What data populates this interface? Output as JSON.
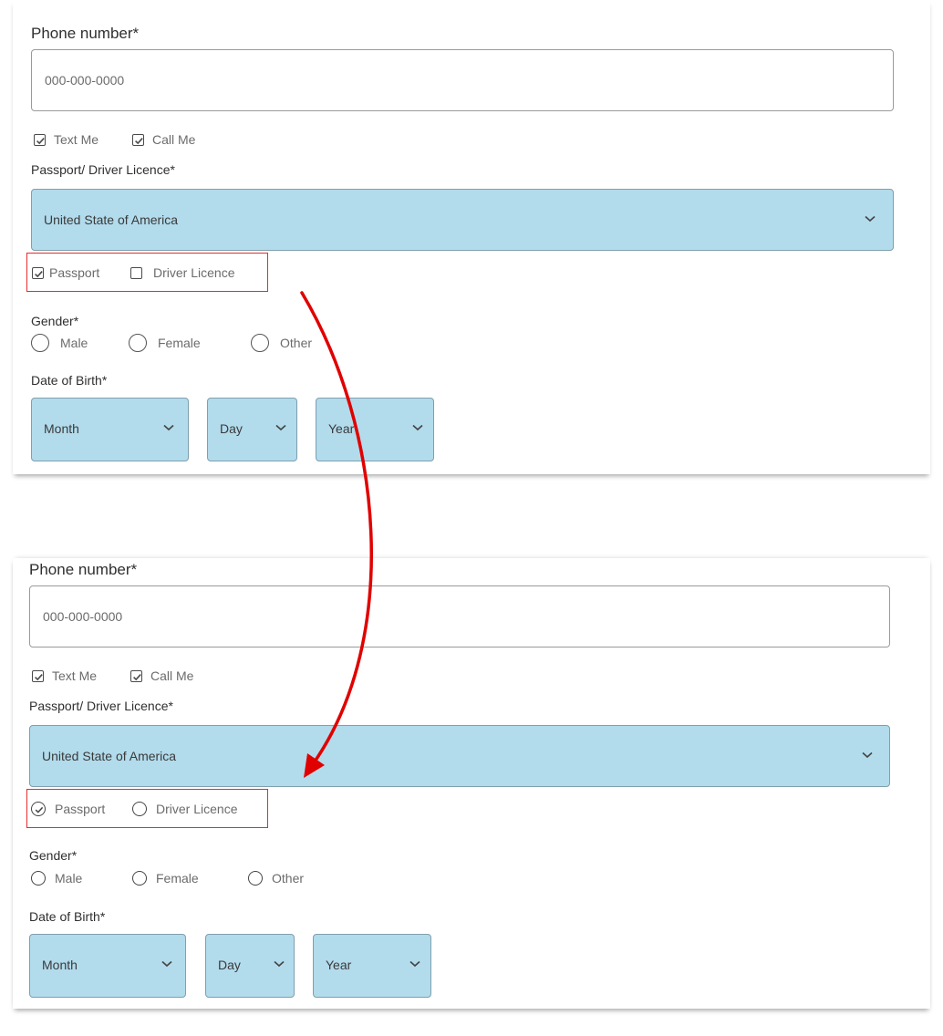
{
  "colors": {
    "select_bg": "#b2dbec",
    "highlight": "#e32d2d",
    "arrow": "#e00000"
  },
  "before": {
    "phone_label": "Phone number*",
    "phone_placeholder": "000-000-0000",
    "contact_options": [
      {
        "label": "Text Me",
        "checked": true
      },
      {
        "label": "Call Me",
        "checked": true
      }
    ],
    "id_label": "Passport/ Driver Licence*",
    "country_value": "United State of America",
    "id_type_control": "checkbox",
    "id_type_options": [
      {
        "label": "Passport",
        "checked": true
      },
      {
        "label": "Driver Licence",
        "checked": false
      }
    ],
    "gender_label": "Gender*",
    "gender_options": [
      {
        "label": "Male",
        "selected": false
      },
      {
        "label": "Female",
        "selected": false
      },
      {
        "label": "Other",
        "selected": false
      }
    ],
    "dob_label": "Date of Birth*",
    "dob_selects": [
      {
        "value": "Month"
      },
      {
        "value": "Day"
      },
      {
        "value": "Year"
      }
    ]
  },
  "after": {
    "phone_label": "Phone number*",
    "phone_placeholder": "000-000-0000",
    "contact_options": [
      {
        "label": "Text Me",
        "checked": true
      },
      {
        "label": "Call Me",
        "checked": true
      }
    ],
    "id_label": "Passport/ Driver Licence*",
    "country_value": "United State of America",
    "id_type_control": "radio",
    "id_type_options": [
      {
        "label": "Passport",
        "selected": true
      },
      {
        "label": "Driver Licence",
        "selected": false
      }
    ],
    "gender_label": "Gender*",
    "gender_options": [
      {
        "label": "Male",
        "selected": false
      },
      {
        "label": "Female",
        "selected": false
      },
      {
        "label": "Other",
        "selected": false
      }
    ],
    "dob_label": "Date of Birth*",
    "dob_selects": [
      {
        "value": "Month"
      },
      {
        "value": "Day"
      },
      {
        "value": "Year"
      }
    ]
  }
}
